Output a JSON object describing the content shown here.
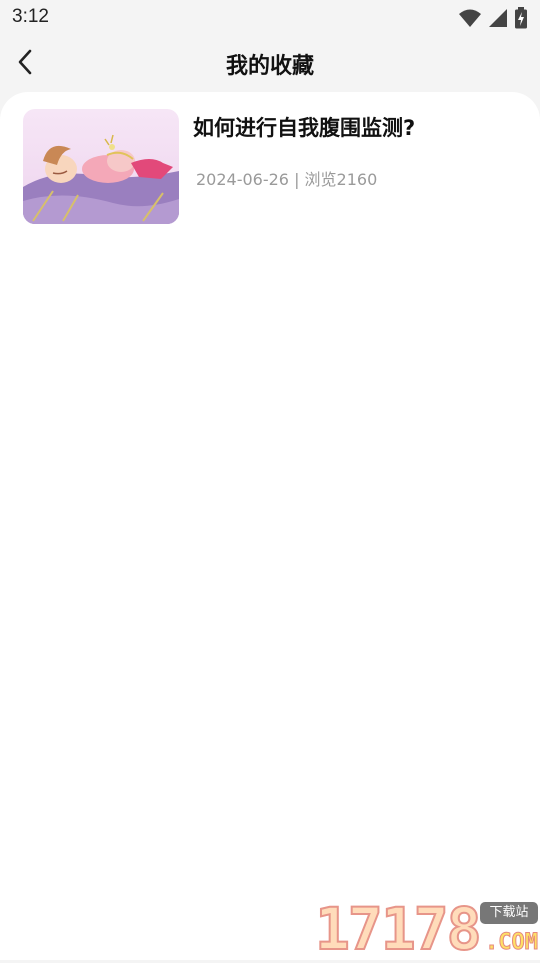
{
  "status_bar": {
    "time": "3:12",
    "icons": [
      "wifi-icon",
      "cellular-signal-icon",
      "battery-charging-icon"
    ]
  },
  "header": {
    "title": "我的收藏",
    "back_icon": "chevron-left-icon"
  },
  "favorites": [
    {
      "title": "如何进行自我腹围监测?",
      "date": "2024-06-26",
      "separator": "|",
      "views": "浏览2160",
      "meta": "2024-06-26 | 浏览2160",
      "thumbnail": "illustration-sleeping-pregnant-woman"
    }
  ],
  "watermark": {
    "digits": "17178",
    "badge": "下载站",
    "domain": ".COM"
  },
  "colors": {
    "page_bg": "#f4f4f4",
    "card_bg": "#ffffff",
    "title_text": "#111111",
    "meta_text": "#9a9a9a"
  }
}
